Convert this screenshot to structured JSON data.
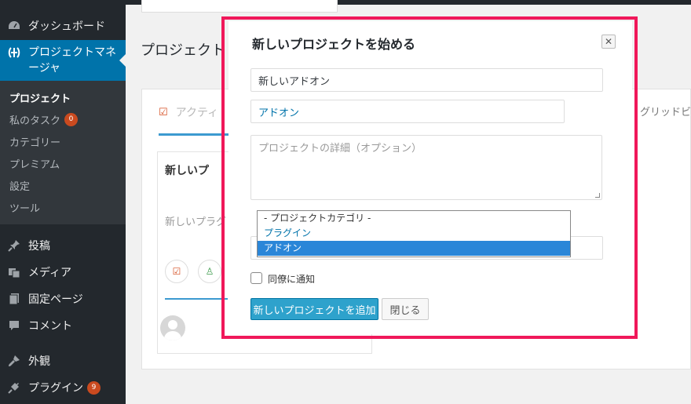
{
  "sidebar": {
    "items": [
      {
        "icon": "dashboard-icon",
        "label": "ダッシュボード"
      },
      {
        "icon": "project-manager-icon",
        "label_line1": "プロジェクトマネ",
        "label_line2": "ージャ"
      },
      {
        "icon": "pin-icon",
        "label": "投稿"
      },
      {
        "icon": "media-icon",
        "label": "メディア"
      },
      {
        "icon": "page-icon",
        "label": "固定ページ"
      },
      {
        "icon": "comment-icon",
        "label": "コメント"
      },
      {
        "icon": "appearance-icon",
        "label": "外観"
      },
      {
        "icon": "plugin-icon",
        "label": "プラグイン",
        "badge": "9"
      }
    ],
    "submenu": [
      {
        "label": "プロジェクト"
      },
      {
        "label": "私のタスク",
        "badge": "0"
      },
      {
        "label": "カテゴリー"
      },
      {
        "label": "プレミアム"
      },
      {
        "label": "設定"
      },
      {
        "label": "ツール"
      }
    ]
  },
  "page": {
    "title": "プロジェクト",
    "tab_active": "アクティ",
    "tab_right": "グリッドビ",
    "card_title": "新しいプ",
    "card_desc": "新しいプラグ"
  },
  "modal": {
    "title": "新しいプロジェクトを始める",
    "name_value": "新しいアドオン",
    "category_value": "アドオン",
    "details_placeholder": "プロジェクトの詳細（オプション）",
    "dropdown_options": [
      "- プロジェクトカテゴリ -",
      "プラグイン",
      "アドオン"
    ],
    "notify_label": "同僚に通知",
    "add_button": "新しいプロジェクトを追加",
    "close_button": "閉じる"
  },
  "colors": {
    "sidebar_bg": "#23282d",
    "accent": "#0073aa",
    "highlight": "#f0185a",
    "primary_button": "#2ea2cc"
  }
}
